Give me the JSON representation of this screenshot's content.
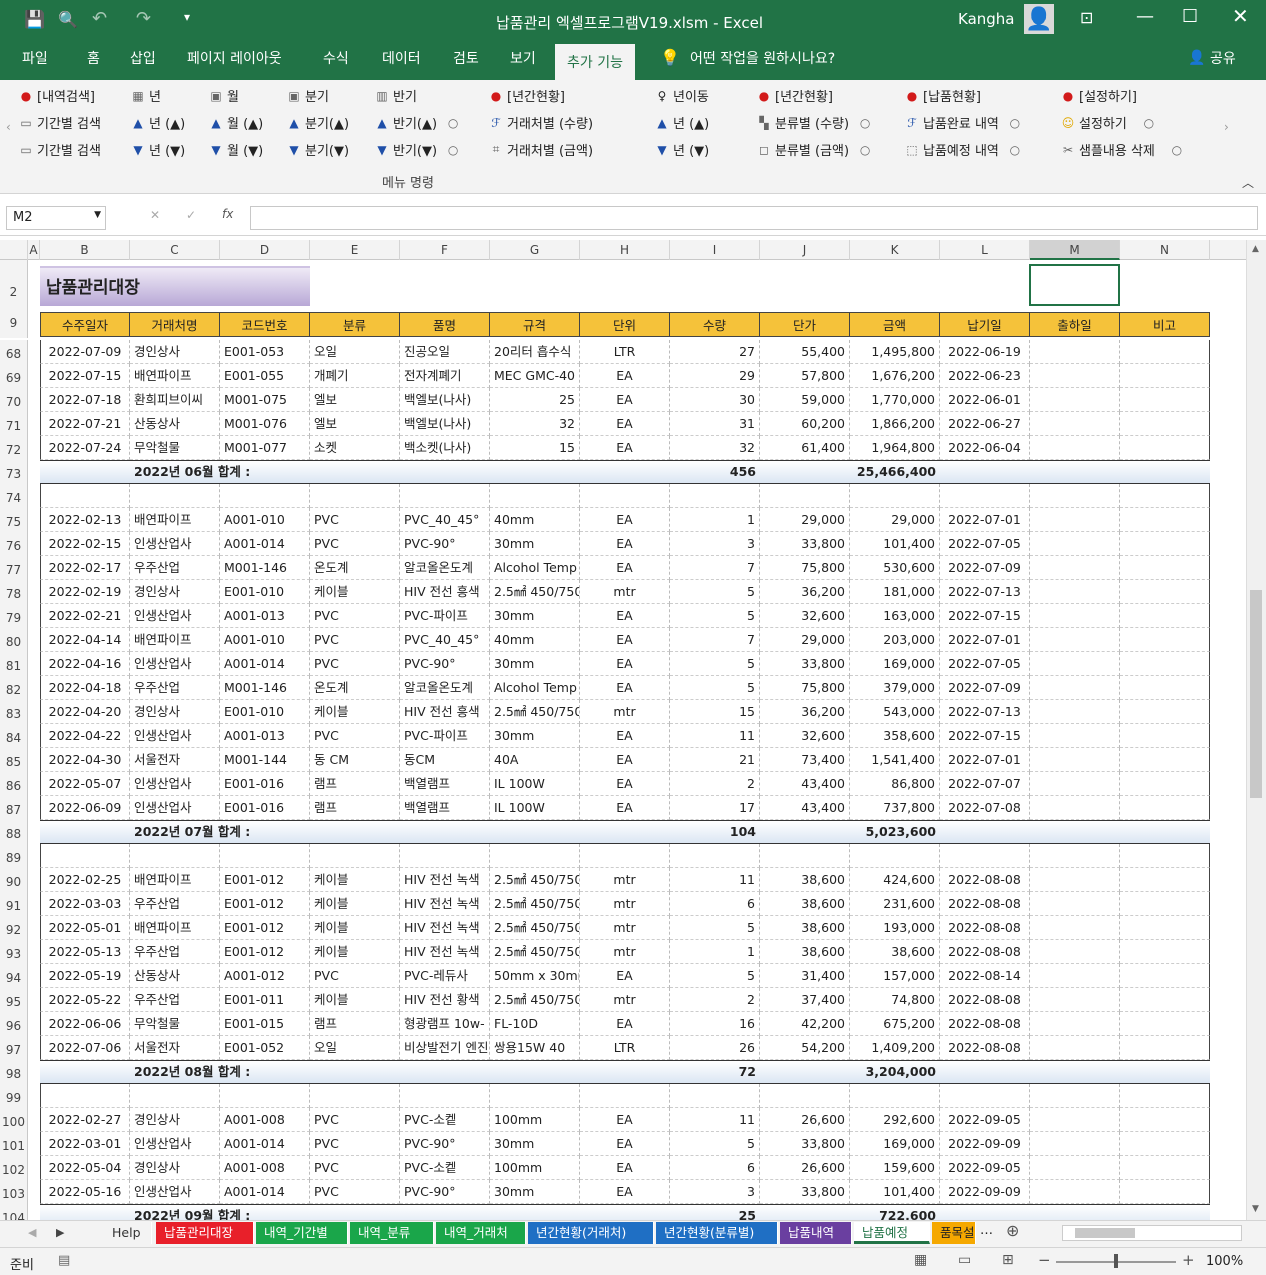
{
  "title": "납품관리 엑셀프로그램V19.xlsm  -  Excel",
  "user": "Kangha",
  "tabs": [
    "파일",
    "홈",
    "삽입",
    "페이지 레이아웃",
    "수식",
    "데이터",
    "검토",
    "보기",
    "추가 기능"
  ],
  "tell_me": "어떤 작업을 원하시나요?",
  "share": "공유",
  "ribbon": {
    "c1": [
      "[내역검색]",
      "기간별 검색",
      "기간별 검색"
    ],
    "c2": [
      "년",
      "년 (▲)",
      "년 (▼)"
    ],
    "c3": [
      "월",
      "월 (▲)",
      "월 (▼)"
    ],
    "c4": [
      "분기",
      "분기(▲)",
      "분기(▼)"
    ],
    "c5": [
      "반기",
      "반기(▲)",
      "반기(▼)"
    ],
    "c6": [
      "[년간현황]",
      "거래처별 (수량)",
      "거래처별 (금액)"
    ],
    "c7": [
      "년이동",
      "년 (▲)",
      "년 (▼)"
    ],
    "c8": [
      "[년간현황]",
      "분류별 (수량)",
      "분류별 (금액)"
    ],
    "c9": [
      "[납품현황]",
      "납품완료 내역",
      "납품예정 내역"
    ],
    "c10": [
      "[설정하기]",
      "설정하기",
      "샘플내용 삭제"
    ],
    "group_label": "메뉴 명령"
  },
  "namebox": "M2",
  "columns": [
    "A",
    "B",
    "C",
    "D",
    "E",
    "F",
    "G",
    "H",
    "I",
    "J",
    "K",
    "L",
    "M",
    "N"
  ],
  "sheet_title": "납품관리대장",
  "headers": [
    "수주일자",
    "거래처명",
    "코드번호",
    "분류",
    "품명",
    "규격",
    "단위",
    "수량",
    "단가",
    "금액",
    "납기일",
    "출하일",
    "비고"
  ],
  "rows": [
    {
      "r": "68",
      "c": [
        "2022-07-09",
        "경인상사",
        "E001-053",
        "오일",
        "진공오일",
        "20리터 흡수식",
        "LTR",
        "27",
        "55,400",
        "1,495,800",
        "2022-06-19",
        "",
        ""
      ]
    },
    {
      "r": "69",
      "c": [
        "2022-07-15",
        "배연파이프",
        "E001-055",
        "개폐기",
        "전자계폐기",
        "MEC GMC-40",
        "EA",
        "29",
        "57,800",
        "1,676,200",
        "2022-06-23",
        "",
        ""
      ]
    },
    {
      "r": "70",
      "c": [
        "2022-07-18",
        "환희피브이씨",
        "M001-075",
        "엘보",
        "백엘보(나사)",
        "25",
        "EA",
        "30",
        "59,000",
        "1,770,000",
        "2022-06-01",
        "",
        ""
      ]
    },
    {
      "r": "71",
      "c": [
        "2022-07-21",
        "산동상사",
        "M001-076",
        "엘보",
        "백엘보(나사)",
        "32",
        "EA",
        "31",
        "60,200",
        "1,866,200",
        "2022-06-27",
        "",
        ""
      ]
    },
    {
      "r": "72",
      "c": [
        "2022-07-24",
        "무악철물",
        "M001-077",
        "소켓",
        "백소켓(나사)",
        "15",
        "EA",
        "32",
        "61,400",
        "1,964,800",
        "2022-06-04",
        "",
        ""
      ]
    },
    {
      "r": "73",
      "sum": true,
      "label": "2022년 06월 합계  :",
      "qty": "456",
      "amt": "25,466,400"
    },
    {
      "r": "74",
      "c": [
        "",
        "",
        "",
        "",
        "",
        "",
        "",
        "",
        "",
        "",
        "",
        "",
        ""
      ]
    },
    {
      "r": "75",
      "c": [
        "2022-02-13",
        "배연파이프",
        "A001-010",
        "PVC",
        "PVC_40_45°",
        "40mm",
        "EA",
        "1",
        "29,000",
        "29,000",
        "2022-07-01",
        "",
        ""
      ]
    },
    {
      "r": "76",
      "c": [
        "2022-02-15",
        "인생산업사",
        "A001-014",
        "PVC",
        "PVC-90°",
        "30mm",
        "EA",
        "3",
        "33,800",
        "101,400",
        "2022-07-05",
        "",
        ""
      ]
    },
    {
      "r": "77",
      "c": [
        "2022-02-17",
        "우주산업",
        "M001-146",
        "온도계",
        "알코올온도계",
        "Alcohol Temp",
        "EA",
        "7",
        "75,800",
        "530,600",
        "2022-07-09",
        "",
        ""
      ]
    },
    {
      "r": "78",
      "c": [
        "2022-02-19",
        "경인상사",
        "E001-010",
        "케이블",
        "HIV  전선 흥색",
        "2.5㎟ 450/750V",
        "mtr",
        "5",
        "36,200",
        "181,000",
        "2022-07-13",
        "",
        ""
      ]
    },
    {
      "r": "79",
      "c": [
        "2022-02-21",
        "인생산업사",
        "A001-013",
        "PVC",
        "PVC-파이프",
        "30mm",
        "EA",
        "5",
        "32,600",
        "163,000",
        "2022-07-15",
        "",
        ""
      ]
    },
    {
      "r": "80",
      "c": [
        "2022-04-14",
        "배연파이프",
        "A001-010",
        "PVC",
        "PVC_40_45°",
        "40mm",
        "EA",
        "7",
        "29,000",
        "203,000",
        "2022-07-01",
        "",
        ""
      ]
    },
    {
      "r": "81",
      "c": [
        "2022-04-16",
        "인생산업사",
        "A001-014",
        "PVC",
        "PVC-90°",
        "30mm",
        "EA",
        "5",
        "33,800",
        "169,000",
        "2022-07-05",
        "",
        ""
      ]
    },
    {
      "r": "82",
      "c": [
        "2022-04-18",
        "우주산업",
        "M001-146",
        "온도계",
        "알코올온도계",
        "Alcohol Temp",
        "EA",
        "5",
        "75,800",
        "379,000",
        "2022-07-09",
        "",
        ""
      ]
    },
    {
      "r": "83",
      "c": [
        "2022-04-20",
        "경인상사",
        "E001-010",
        "케이블",
        "HIV  전선 흥색",
        "2.5㎟ 450/750V",
        "mtr",
        "15",
        "36,200",
        "543,000",
        "2022-07-13",
        "",
        ""
      ]
    },
    {
      "r": "84",
      "c": [
        "2022-04-22",
        "인생산업사",
        "A001-013",
        "PVC",
        "PVC-파이프",
        "30mm",
        "EA",
        "11",
        "32,600",
        "358,600",
        "2022-07-15",
        "",
        ""
      ]
    },
    {
      "r": "85",
      "c": [
        "2022-04-30",
        "서울전자",
        "M001-144",
        "동 CM",
        "동CM",
        "40A",
        "EA",
        "21",
        "73,400",
        "1,541,400",
        "2022-07-01",
        "",
        ""
      ]
    },
    {
      "r": "86",
      "c": [
        "2022-05-07",
        "인생산업사",
        "E001-016",
        "램프",
        "백열램프",
        "IL 100W",
        "EA",
        "2",
        "43,400",
        "86,800",
        "2022-07-07",
        "",
        ""
      ]
    },
    {
      "r": "87",
      "c": [
        "2022-06-09",
        "인생산업사",
        "E001-016",
        "램프",
        "백열램프",
        "IL 100W",
        "EA",
        "17",
        "43,400",
        "737,800",
        "2022-07-08",
        "",
        ""
      ]
    },
    {
      "r": "88",
      "sum": true,
      "label": "2022년 07월 합계  :",
      "qty": "104",
      "amt": "5,023,600"
    },
    {
      "r": "89",
      "c": [
        "",
        "",
        "",
        "",
        "",
        "",
        "",
        "",
        "",
        "",
        "",
        "",
        ""
      ]
    },
    {
      "r": "90",
      "c": [
        "2022-02-25",
        "배연파이프",
        "E001-012",
        "케이블",
        "HIV  전선 녹색",
        "2.5㎟ 450/750V",
        "mtr",
        "11",
        "38,600",
        "424,600",
        "2022-08-08",
        "",
        ""
      ]
    },
    {
      "r": "91",
      "c": [
        "2022-03-03",
        "우주산업",
        "E001-012",
        "케이블",
        "HIV  전선 녹색",
        "2.5㎟ 450/750V",
        "mtr",
        "6",
        "38,600",
        "231,600",
        "2022-08-08",
        "",
        ""
      ]
    },
    {
      "r": "92",
      "c": [
        "2022-05-01",
        "배연파이프",
        "E001-012",
        "케이블",
        "HIV  전선 녹색",
        "2.5㎟ 450/750V",
        "mtr",
        "5",
        "38,600",
        "193,000",
        "2022-08-08",
        "",
        ""
      ]
    },
    {
      "r": "93",
      "c": [
        "2022-05-13",
        "우주산업",
        "E001-012",
        "케이블",
        "HIV  전선 녹색",
        "2.5㎟ 450/750V",
        "mtr",
        "1",
        "38,600",
        "38,600",
        "2022-08-08",
        "",
        ""
      ]
    },
    {
      "r": "94",
      "c": [
        "2022-05-19",
        "산동상사",
        "A001-012",
        "PVC",
        "PVC-레듀사",
        "50mm x 30mm",
        "EA",
        "5",
        "31,400",
        "157,000",
        "2022-08-14",
        "",
        ""
      ]
    },
    {
      "r": "95",
      "c": [
        "2022-05-22",
        "우주산업",
        "E001-011",
        "케이블",
        "HIV  전선 황색",
        "2.5㎟ 450/750V",
        "mtr",
        "2",
        "37,400",
        "74,800",
        "2022-08-08",
        "",
        ""
      ]
    },
    {
      "r": "96",
      "c": [
        "2022-06-06",
        "무악철물",
        "E001-015",
        "램프",
        "형광램프 10w-",
        "FL-10D",
        "EA",
        "16",
        "42,200",
        "675,200",
        "2022-08-08",
        "",
        ""
      ]
    },
    {
      "r": "97",
      "c": [
        "2022-07-06",
        "서울전자",
        "E001-052",
        "오일",
        "비상발전기 엔진",
        "쌍용15W 40",
        "LTR",
        "26",
        "54,200",
        "1,409,200",
        "2022-08-08",
        "",
        ""
      ]
    },
    {
      "r": "98",
      "sum": true,
      "label": "2022년 08월 합계  :",
      "qty": "72",
      "amt": "3,204,000"
    },
    {
      "r": "99",
      "c": [
        "",
        "",
        "",
        "",
        "",
        "",
        "",
        "",
        "",
        "",
        "",
        "",
        ""
      ]
    },
    {
      "r": "100",
      "c": [
        "2022-02-27",
        "경인상사",
        "A001-008",
        "PVC",
        "PVC-소켙",
        "100mm",
        "EA",
        "11",
        "26,600",
        "292,600",
        "2022-09-05",
        "",
        ""
      ]
    },
    {
      "r": "101",
      "c": [
        "2022-03-01",
        "인생산업사",
        "A001-014",
        "PVC",
        "PVC-90°",
        "30mm",
        "EA",
        "5",
        "33,800",
        "169,000",
        "2022-09-09",
        "",
        ""
      ]
    },
    {
      "r": "102",
      "c": [
        "2022-05-04",
        "경인상사",
        "A001-008",
        "PVC",
        "PVC-소켙",
        "100mm",
        "EA",
        "6",
        "26,600",
        "159,600",
        "2022-09-05",
        "",
        ""
      ]
    },
    {
      "r": "103",
      "c": [
        "2022-05-16",
        "인생산업사",
        "A001-014",
        "PVC",
        "PVC-90°",
        "30mm",
        "EA",
        "3",
        "33,800",
        "101,400",
        "2022-09-09",
        "",
        ""
      ]
    },
    {
      "r": "104",
      "sum": true,
      "label": "2022년 09월 합계  :",
      "qty": "25",
      "amt": "722,600"
    }
  ],
  "sheets": [
    {
      "name": "Help",
      "bg": "#f3f3f3",
      "fg": "#333"
    },
    {
      "name": "납품관리대장",
      "bg": "#e8202a",
      "fg": "#fff"
    },
    {
      "name": "내역_기간별",
      "bg": "#1aa64a",
      "fg": "#fff"
    },
    {
      "name": "내역_분류",
      "bg": "#1aa64a",
      "fg": "#fff"
    },
    {
      "name": "내역_거래처",
      "bg": "#1aa64a",
      "fg": "#fff"
    },
    {
      "name": "년간현황(거래처)",
      "bg": "#1f6fc4",
      "fg": "#fff"
    },
    {
      "name": "년간현황(분류별)",
      "bg": "#1f6fc4",
      "fg": "#fff"
    },
    {
      "name": "납품내역",
      "bg": "#6a3fa0",
      "fg": "#fff"
    },
    {
      "name": "납품예정",
      "bg": "#ffffff",
      "fg": "#217346"
    },
    {
      "name": "품목설",
      "bg": "#f5a800",
      "fg": "#222"
    }
  ],
  "status": {
    "ready": "준비",
    "zoom": "100%"
  }
}
